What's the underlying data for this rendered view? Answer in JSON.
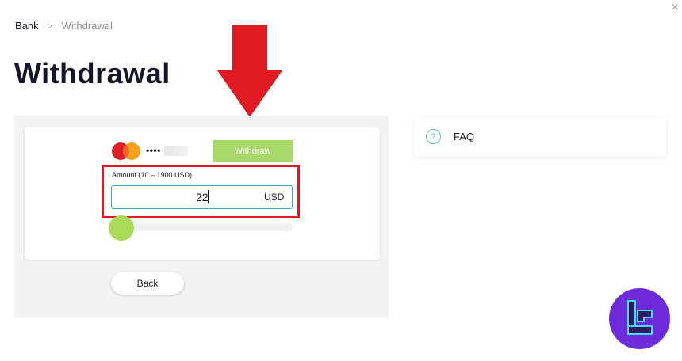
{
  "window": {
    "close_glyph": "×"
  },
  "breadcrumb": {
    "root": "Bank",
    "separator": ">",
    "current": "Withdrawal"
  },
  "page": {
    "title": "Withdrawal"
  },
  "payment_method": {
    "brand_icon": "mastercard-logo",
    "masked_number": "••••"
  },
  "withdraw_button": {
    "label": "Withdraw"
  },
  "amount": {
    "label": "Amount (10 – 1900 USD)",
    "value": "22",
    "currency": "USD",
    "min": 10,
    "max": 1900
  },
  "slider": {
    "level": 0
  },
  "back_button": {
    "label": "Back"
  },
  "faq": {
    "label": "FAQ",
    "icon": "question-circle-icon",
    "icon_glyph": "?"
  },
  "colors": {
    "accent_green": "#a8d86a",
    "highlight_red": "#e01a22",
    "input_border": "#3aa3c8",
    "faq_teal": "#5cc6a0",
    "badge_purple": "#6d2bd9"
  }
}
